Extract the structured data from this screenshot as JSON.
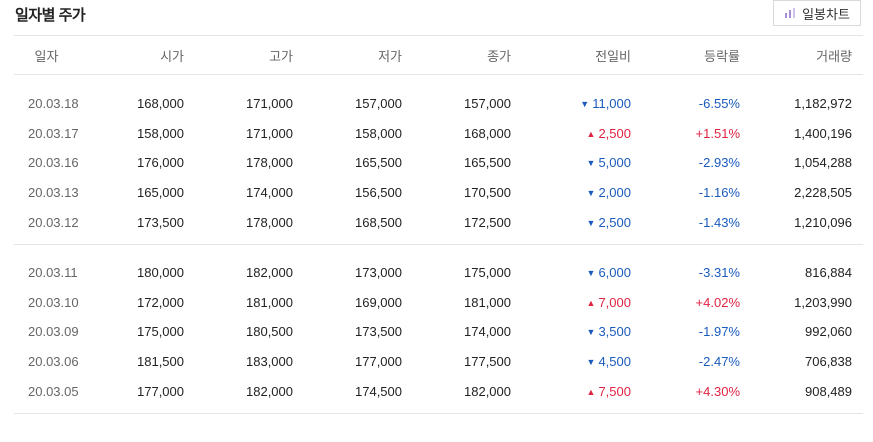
{
  "title": "일자별 주가",
  "chart_button": {
    "label": "일봉차트",
    "icon": "bar-chart-icon"
  },
  "colors": {
    "up": "#e12343",
    "down": "#1a5bbd",
    "icon": "#a88fd8"
  },
  "columns": [
    "일자",
    "시가",
    "고가",
    "저가",
    "종가",
    "전일비",
    "등락률",
    "거래량"
  ],
  "groups": [
    [
      {
        "date": "20.03.18",
        "open": "168,000",
        "high": "171,000",
        "low": "157,000",
        "close": "157,000",
        "change": "11,000",
        "dir": "down",
        "rate": "-6.55%",
        "volume": "1,182,972"
      },
      {
        "date": "20.03.17",
        "open": "158,000",
        "high": "171,000",
        "low": "158,000",
        "close": "168,000",
        "change": "2,500",
        "dir": "up",
        "rate": "+1.51%",
        "volume": "1,400,196"
      },
      {
        "date": "20.03.16",
        "open": "176,000",
        "high": "178,000",
        "low": "165,500",
        "close": "165,500",
        "change": "5,000",
        "dir": "down",
        "rate": "-2.93%",
        "volume": "1,054,288"
      },
      {
        "date": "20.03.13",
        "open": "165,000",
        "high": "174,000",
        "low": "156,500",
        "close": "170,500",
        "change": "2,000",
        "dir": "down",
        "rate": "-1.16%",
        "volume": "2,228,505"
      },
      {
        "date": "20.03.12",
        "open": "173,500",
        "high": "178,000",
        "low": "168,500",
        "close": "172,500",
        "change": "2,500",
        "dir": "down",
        "rate": "-1.43%",
        "volume": "1,210,096"
      }
    ],
    [
      {
        "date": "20.03.11",
        "open": "180,000",
        "high": "182,000",
        "low": "173,000",
        "close": "175,000",
        "change": "6,000",
        "dir": "down",
        "rate": "-3.31%",
        "volume": "816,884"
      },
      {
        "date": "20.03.10",
        "open": "172,000",
        "high": "181,000",
        "low": "169,000",
        "close": "181,000",
        "change": "7,000",
        "dir": "up",
        "rate": "+4.02%",
        "volume": "1,203,990"
      },
      {
        "date": "20.03.09",
        "open": "175,000",
        "high": "180,500",
        "low": "173,500",
        "close": "174,000",
        "change": "3,500",
        "dir": "down",
        "rate": "-1.97%",
        "volume": "992,060"
      },
      {
        "date": "20.03.06",
        "open": "181,500",
        "high": "183,000",
        "low": "177,000",
        "close": "177,500",
        "change": "4,500",
        "dir": "down",
        "rate": "-2.47%",
        "volume": "706,838"
      },
      {
        "date": "20.03.05",
        "open": "177,000",
        "high": "182,000",
        "low": "174,500",
        "close": "182,000",
        "change": "7,500",
        "dir": "up",
        "rate": "+4.30%",
        "volume": "908,489"
      }
    ]
  ]
}
